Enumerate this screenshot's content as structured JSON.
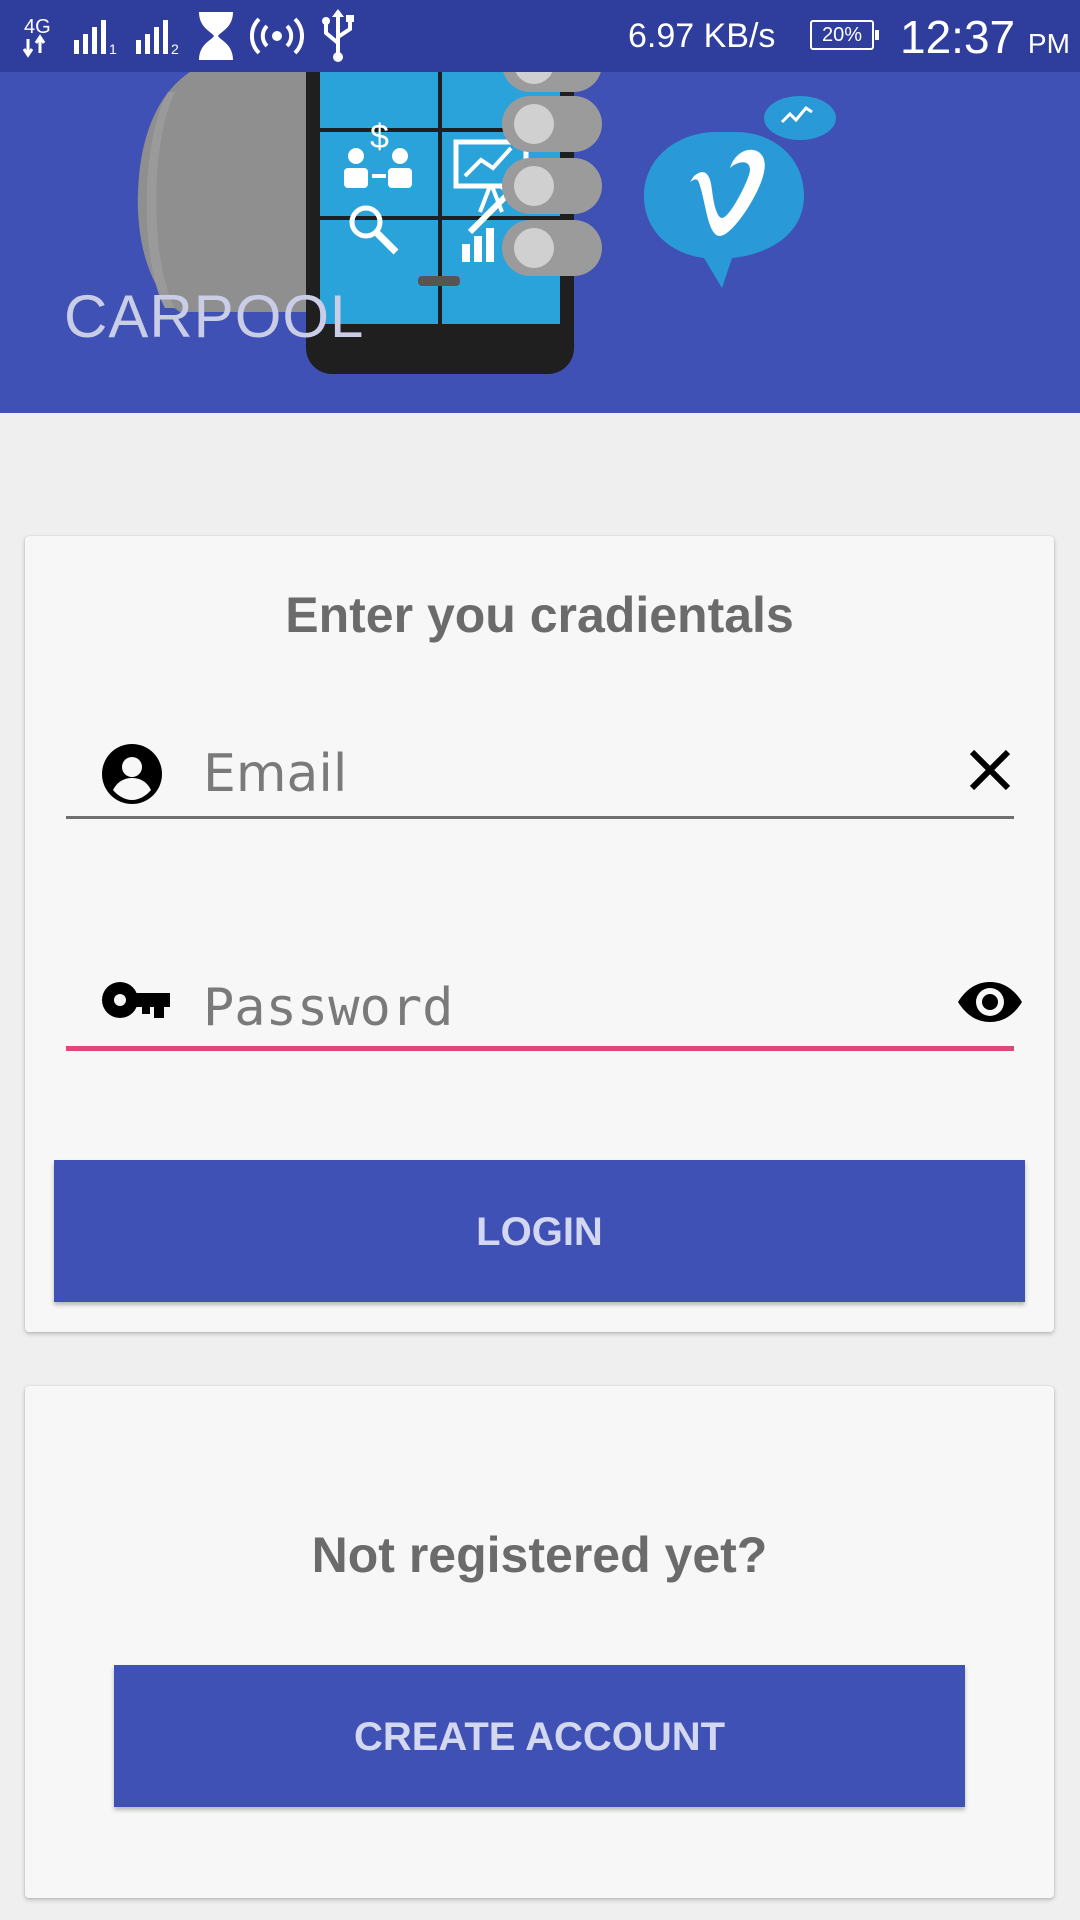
{
  "status_bar": {
    "network_speed": "6.97 KB/s",
    "battery": "20%",
    "time": "12:37",
    "ampm": "PM",
    "icons": [
      "4g-icon",
      "signal-sim1-icon",
      "signal-sim2-icon",
      "hourglass-icon",
      "hotspot-icon",
      "usb-icon"
    ]
  },
  "header": {
    "brand": "CARPOOL",
    "colors": {
      "background": "#3f51b5",
      "status_bar": "#2f3d9c"
    }
  },
  "login_card": {
    "title": "Enter you cradientals",
    "email": {
      "placeholder": "Email",
      "value": "",
      "icon": "account-circle-icon",
      "action_icon": "clear-icon"
    },
    "password": {
      "placeholder": "Password",
      "value": "",
      "icon": "key-icon",
      "action_icon": "eye-icon"
    },
    "login_button": "LOGIN"
  },
  "register_card": {
    "title": "Not registered yet?",
    "create_button": "CREATE ACCOUNT"
  },
  "colors": {
    "accent": "#3f51b5",
    "focus_underline": "#e2457b"
  }
}
